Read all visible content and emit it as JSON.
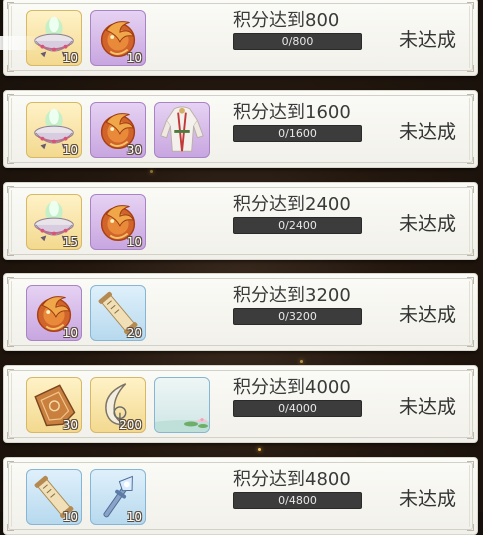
{
  "rows": [
    {
      "title": "积分达到800",
      "progress_text": "0/800",
      "progress": 0,
      "status": "未达成",
      "rewards": [
        {
          "icon": "incense-bowl-icon",
          "qty": "10"
        },
        {
          "icon": "phoenix-emblem-icon",
          "qty": "10"
        }
      ]
    },
    {
      "title": "积分达到1600",
      "progress_text": "0/1600",
      "progress": 0,
      "status": "未达成",
      "rewards": [
        {
          "icon": "incense-bowl-icon",
          "qty": "10"
        },
        {
          "icon": "phoenix-emblem-icon",
          "qty": "30"
        },
        {
          "icon": "costume-icon",
          "qty": ""
        }
      ]
    },
    {
      "title": "积分达到2400",
      "progress_text": "0/2400",
      "progress": 0,
      "status": "未达成",
      "rewards": [
        {
          "icon": "incense-bowl-icon",
          "qty": "15"
        },
        {
          "icon": "phoenix-emblem-icon",
          "qty": "10"
        }
      ]
    },
    {
      "title": "积分达到3200",
      "progress_text": "0/3200",
      "progress": 0,
      "status": "未达成",
      "rewards": [
        {
          "icon": "phoenix-emblem-icon",
          "qty": "10"
        },
        {
          "icon": "scroll-icon",
          "qty": "20"
        }
      ]
    },
    {
      "title": "积分达到4000",
      "progress_text": "0/4000",
      "progress": 0,
      "status": "未达成",
      "rewards": [
        {
          "icon": "bronze-plaque-icon",
          "qty": "30"
        },
        {
          "icon": "jade-crescent-icon",
          "qty": "200"
        },
        {
          "icon": "lotus-scene-icon",
          "qty": ""
        }
      ]
    },
    {
      "title": "积分达到4800",
      "progress_text": "0/4800",
      "progress": 0,
      "status": "未达成",
      "rewards": [
        {
          "icon": "scroll-icon",
          "qty": "10"
        },
        {
          "icon": "crystal-wand-icon",
          "qty": "10"
        }
      ]
    }
  ]
}
